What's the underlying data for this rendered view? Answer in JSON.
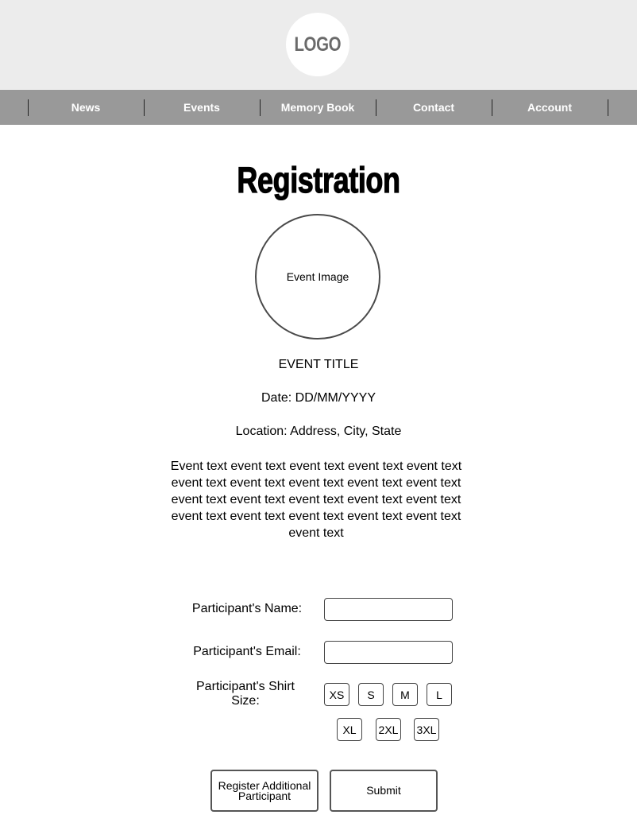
{
  "header": {
    "logo_text": "LOGO"
  },
  "nav": {
    "items": [
      {
        "label": "News"
      },
      {
        "label": "Events"
      },
      {
        "label": "Memory Book"
      },
      {
        "label": "Contact"
      },
      {
        "label": "Account"
      }
    ]
  },
  "main": {
    "page_title": "Registration",
    "event_image_label": "Event Image",
    "event_title": "EVENT TITLE",
    "event_date": "Date: DD/MM/YYYY",
    "event_location": "Location: Address, City, State",
    "event_text": "Event text event text event text event text event text event text event text event text event text event text event text event text event text event text event text event text event text event text event text event text event text"
  },
  "form": {
    "name_label": "Participant's Name:",
    "name_value": "",
    "email_label": "Participant's Email:",
    "email_value": "",
    "shirt_label": "Participant's Shirt Size:",
    "shirt_sizes": [
      "XS",
      "S",
      "M",
      "L",
      "XL",
      "2XL",
      "3XL"
    ],
    "register_additional_label": "Register Additional Participant",
    "submit_label": "Submit"
  },
  "colors": {
    "header_bg": "#ececec",
    "nav_bg": "#999999",
    "nav_text": "#ffffff",
    "logo_text": "#6a6a6a"
  }
}
